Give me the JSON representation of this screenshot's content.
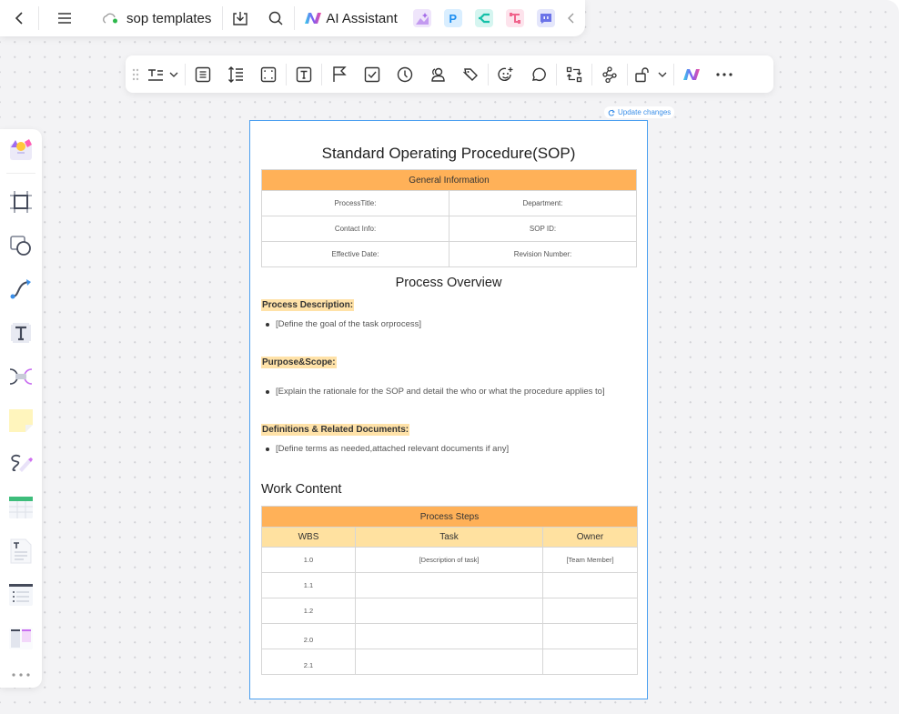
{
  "topbar": {
    "doc_title": "sop templates",
    "ai_label": "AI Assistant",
    "icons": [
      "back-icon",
      "menu-icon",
      "cloud-sync-icon",
      "download-icon",
      "search-icon",
      "ai-logo-icon",
      "ai-image-app-icon",
      "p-app-icon",
      "mindmap-app-icon",
      "flowchart-app-icon",
      "chat-app-icon",
      "collapse-icon"
    ],
    "app_letter_p": "P"
  },
  "toolbar": {
    "tools": [
      "drag-handle",
      "text-style",
      "align",
      "line-spacing",
      "fit-frame",
      "text-box",
      "flag",
      "checkbox",
      "clock",
      "user",
      "tag",
      "emoji-add",
      "comment",
      "replace",
      "connect",
      "lock",
      "ai",
      "more"
    ]
  },
  "leftpanel": {
    "tools": [
      "templates",
      "frame",
      "shapes",
      "connector",
      "text",
      "mindmap",
      "sticky-note",
      "pen",
      "table",
      "document",
      "list",
      "kanban",
      "more"
    ]
  },
  "canvas": {
    "update_label": "Update changes"
  },
  "document": {
    "title": "Standard Operating Procedure(SOP)",
    "general_info": {
      "header": "General Information",
      "rows": [
        [
          "ProcessTitle:",
          "Department:"
        ],
        [
          "Contact Info:",
          "SOP ID:"
        ],
        [
          "Effective Date:",
          "Revision Number:"
        ]
      ]
    },
    "overview": {
      "heading": "Process Overview",
      "sections": [
        {
          "label": "Process Description:",
          "bullet": "[Define the goal of the task orprocess]"
        },
        {
          "label": "Purpose&Scope:",
          "bullet": "[Explain the rationale for the SOP and detail the who or what the procedure applies to]"
        },
        {
          "label": "Definitions & Related Documents:",
          "bullet": "[Define terms as needed,attached relevant documents if any]"
        }
      ]
    },
    "work_content": {
      "heading": "Work Content",
      "table_header": "Process Steps",
      "columns": [
        "WBS",
        "Task",
        "Owner"
      ],
      "rows": [
        [
          "1.0",
          "[Description of task]",
          "[Team Member]"
        ],
        [
          "1.1",
          "",
          ""
        ],
        [
          "1.2",
          "",
          ""
        ],
        [
          "2.0",
          "",
          ""
        ],
        [
          "2.1",
          "",
          ""
        ]
      ]
    }
  },
  "colors": {
    "accent_blue": "#4a9ff0",
    "header_orange": "#ffb158",
    "header_light": "#ffe1a0",
    "highlight": "#ffe2a8"
  }
}
